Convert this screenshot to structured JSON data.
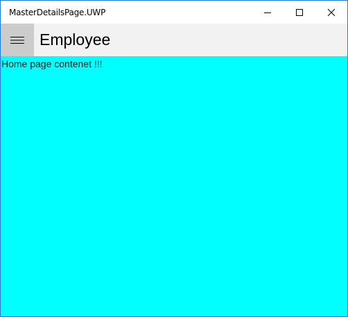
{
  "window": {
    "title": "MasterDetailsPage.UWP",
    "border_color": "#1e7ad6"
  },
  "window_controls": {
    "minimize_icon": "minimize-icon",
    "maximize_icon": "maximize-icon",
    "close_icon": "close-icon"
  },
  "appbar": {
    "menu_icon": "hamburger-menu-icon",
    "title": "Employee",
    "background": "#f2f2f2",
    "menu_background": "#cccccc"
  },
  "content": {
    "text": "Home page contenet !!!",
    "background": "#00ffff"
  }
}
